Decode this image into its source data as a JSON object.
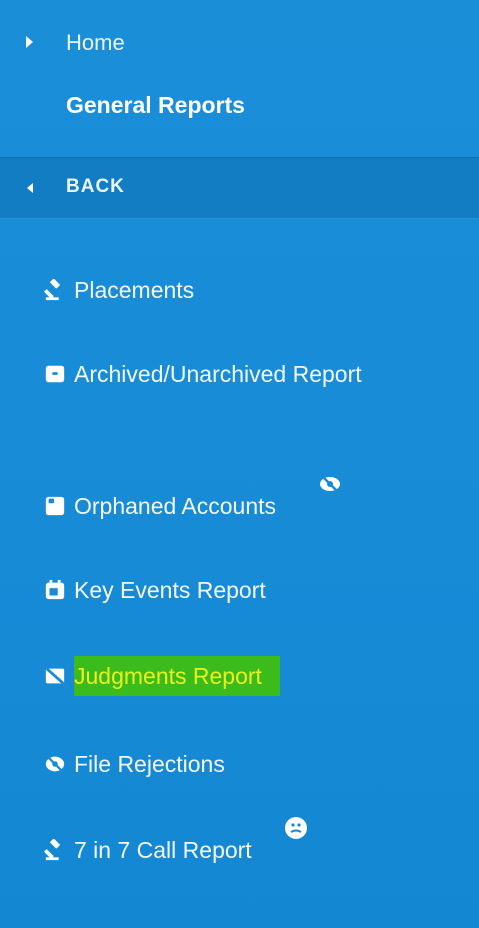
{
  "nav": {
    "home_label": "Home",
    "section_title": "General Reports",
    "back_label": "BACK"
  },
  "menu": {
    "items": [
      {
        "label": "Placements",
        "icon": "gavel-icon"
      },
      {
        "label": "Archived/Unarchived Report",
        "icon": "archive-icon"
      },
      {
        "label": "Orphaned Accounts",
        "icon": "square-icon"
      },
      {
        "label": "Key Events Report",
        "icon": "calendar-icon"
      },
      {
        "label": "Judgments Report",
        "icon": "eye-slash-card-icon",
        "highlighted": true
      },
      {
        "label": "File Rejections",
        "icon": "eye-slash-icon"
      },
      {
        "label": "7 in 7 Call Report",
        "icon": "gavel-icon"
      }
    ]
  },
  "colors": {
    "sidebar_bg": "#1a8ad6",
    "back_bar_bg": "#137dc4",
    "highlight_bg": "#3cbc1c",
    "highlight_text": "#e9f21d"
  }
}
